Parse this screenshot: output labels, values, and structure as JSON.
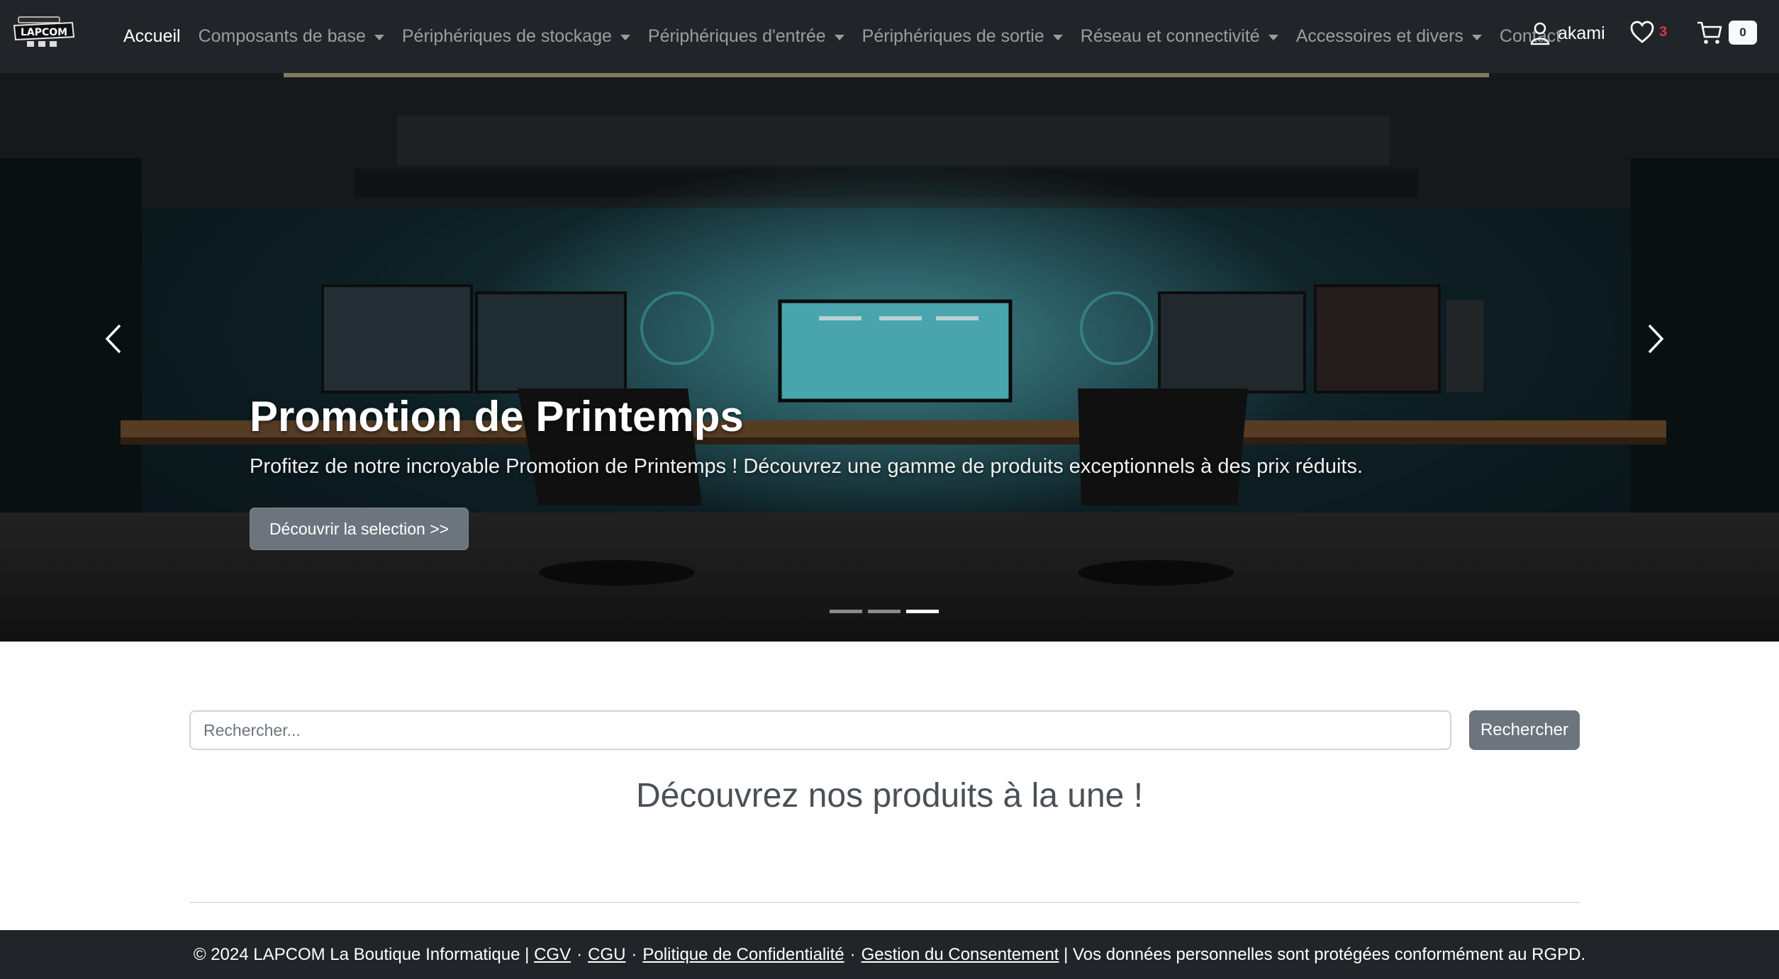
{
  "brand": {
    "logo_text": "LAPCOM",
    "logo_icon": "lapcom-logo-icon"
  },
  "nav": {
    "items": [
      {
        "label": "Accueil",
        "active": true,
        "dropdown": false
      },
      {
        "label": "Composants de base",
        "dropdown": true
      },
      {
        "label": "Périphériques de stockage",
        "dropdown": true
      },
      {
        "label": "Périphériques d'entrée",
        "dropdown": true
      },
      {
        "label": "Périphériques de sortie",
        "dropdown": true
      },
      {
        "label": "Réseau et connectivité",
        "dropdown": true
      },
      {
        "label": "Accessoires et divers",
        "dropdown": true
      },
      {
        "label": "Contact",
        "dropdown": false
      }
    ],
    "user": {
      "name": "akami",
      "icon": "user-icon"
    },
    "wishlist": {
      "count": "3",
      "icon": "heart-icon"
    },
    "cart": {
      "count": "0",
      "icon": "cart-icon"
    }
  },
  "hero": {
    "title": "Promotion de Printemps",
    "text": "Profitez de notre incroyable Promotion de Printemps ! Découvrez une gamme de produits exceptionnels à des prix réduits.",
    "button_label": "Découvrir la selection >>",
    "slides_total": 3,
    "active_slide": 3,
    "prev_icon": "chevron-left-icon",
    "next_icon": "chevron-right-icon"
  },
  "search": {
    "placeholder": "Rechercher...",
    "button_label": "Rechercher"
  },
  "featured": {
    "title": "Découvrez nos produits à la une !"
  },
  "footer": {
    "copyright": "© 2024 LAPCOM La Boutique Informatique |",
    "links": [
      "CGV",
      "CGU",
      "Politique de Confidentialité",
      "Gestion du Consentement"
    ],
    "separator": "·",
    "notice": "| Vos données personnelles sont protégées conformément au RGPD."
  },
  "colors": {
    "navbar": "#212529",
    "button": "#6c757d",
    "badge_red": "#dc3545"
  }
}
